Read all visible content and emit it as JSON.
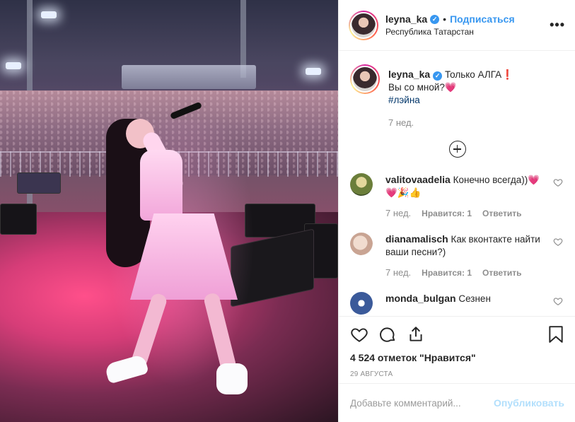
{
  "header": {
    "username": "leyna_ka",
    "separator": "•",
    "follow_label": "Подписаться",
    "location": "Республика Татарстан",
    "more_label": "•••"
  },
  "caption": {
    "username": "leyna_ka",
    "line1": "Только АЛГА❗️",
    "line2": "Вы со мной?💗",
    "hashtag": "#лэйна",
    "time": "7 нед."
  },
  "comments": [
    {
      "username": "valitovaadelia",
      "text": "Конечно всегда))💗💗🎉👍",
      "time": "7 нед.",
      "likes": "Нравится: 1",
      "reply": "Ответить"
    },
    {
      "username": "dianamalisch",
      "text": "Как вконтакте найти ваши песни?)",
      "time": "7 нед.",
      "likes": "Нравится: 1",
      "reply": "Ответить"
    },
    {
      "username": "monda_bulgan",
      "text": "Сезнен"
    }
  ],
  "post": {
    "likes": "4 524 отметок \"Нравится\"",
    "date": "29 августа"
  },
  "add_comment": {
    "placeholder": "Добавьте комментарий...",
    "publish_label": "Опубликовать"
  },
  "colors": {
    "link": "#3897f0",
    "hashtag": "#003569",
    "muted": "#8e8e8e",
    "publish_disabled": "#b2dffc"
  }
}
